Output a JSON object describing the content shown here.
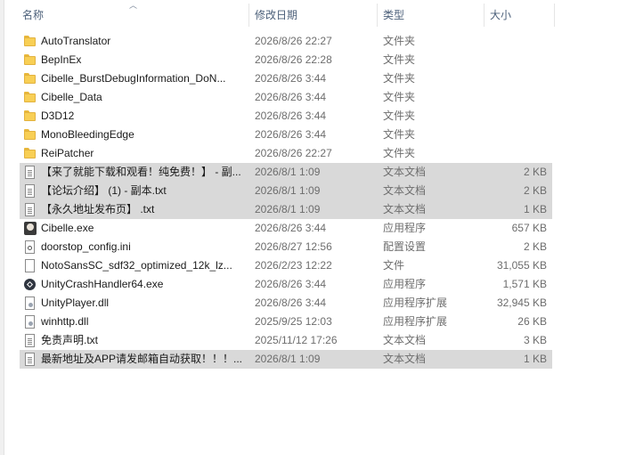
{
  "columns": {
    "name": "名称",
    "date": "修改日期",
    "type": "类型",
    "size": "大小"
  },
  "files": [
    {
      "name": "AutoTranslator",
      "date": "2026/8/26 22:27",
      "type": "文件夹",
      "size": "",
      "icon": "folder-icon",
      "selected": false
    },
    {
      "name": "BepInEx",
      "date": "2026/8/26 22:28",
      "type": "文件夹",
      "size": "",
      "icon": "folder-icon",
      "selected": false
    },
    {
      "name": "Cibelle_BurstDebugInformation_DoN...",
      "date": "2026/8/26 3:44",
      "type": "文件夹",
      "size": "",
      "icon": "folder-icon",
      "selected": false
    },
    {
      "name": "Cibelle_Data",
      "date": "2026/8/26 3:44",
      "type": "文件夹",
      "size": "",
      "icon": "folder-icon",
      "selected": false
    },
    {
      "name": "D3D12",
      "date": "2026/8/26 3:44",
      "type": "文件夹",
      "size": "",
      "icon": "folder-icon",
      "selected": false
    },
    {
      "name": "MonoBleedingEdge",
      "date": "2026/8/26 3:44",
      "type": "文件夹",
      "size": "",
      "icon": "folder-icon",
      "selected": false
    },
    {
      "name": "ReiPatcher",
      "date": "2026/8/26 22:27",
      "type": "文件夹",
      "size": "",
      "icon": "folder-icon",
      "selected": false
    },
    {
      "name": "【来了就能下载和观看！纯免费！】 - 副...",
      "date": "2026/8/1 1:09",
      "type": "文本文档",
      "size": "2 KB",
      "icon": "text-file-icon",
      "selected": true
    },
    {
      "name": "【论坛介绍】 (1) - 副本.txt",
      "date": "2026/8/1 1:09",
      "type": "文本文档",
      "size": "2 KB",
      "icon": "text-file-icon",
      "selected": true
    },
    {
      "name": "【永久地址发布页】 .txt",
      "date": "2026/8/1 1:09",
      "type": "文本文档",
      "size": "1 KB",
      "icon": "text-file-icon",
      "selected": true
    },
    {
      "name": "Cibelle.exe",
      "date": "2026/8/26 3:44",
      "type": "应用程序",
      "size": "657 KB",
      "icon": "app-icon",
      "selected": false
    },
    {
      "name": "doorstop_config.ini",
      "date": "2026/8/27 12:56",
      "type": "配置设置",
      "size": "2 KB",
      "icon": "config-file-icon",
      "selected": false
    },
    {
      "name": "NotoSansSC_sdf32_optimized_12k_lz...",
      "date": "2026/2/23 12:22",
      "type": "文件",
      "size": "31,055 KB",
      "icon": "file-icon",
      "selected": false
    },
    {
      "name": "UnityCrashHandler64.exe",
      "date": "2026/8/26 3:44",
      "type": "应用程序",
      "size": "1,571 KB",
      "icon": "unity-icon",
      "selected": false
    },
    {
      "name": "UnityPlayer.dll",
      "date": "2026/8/26 3:44",
      "type": "应用程序扩展",
      "size": "32,945 KB",
      "icon": "dll-icon",
      "selected": false
    },
    {
      "name": "winhttp.dll",
      "date": "2025/9/25 12:03",
      "type": "应用程序扩展",
      "size": "26 KB",
      "icon": "dll-icon",
      "selected": false
    },
    {
      "name": "免责声明.txt",
      "date": "2025/11/12 17:26",
      "type": "文本文档",
      "size": "3 KB",
      "icon": "text-file-icon",
      "selected": false
    },
    {
      "name": "最新地址及APP请发邮箱自动获取！！！...",
      "date": "2026/8/1 1:09",
      "type": "文本文档",
      "size": "1 KB",
      "icon": "text-file-icon",
      "selected": true
    }
  ]
}
